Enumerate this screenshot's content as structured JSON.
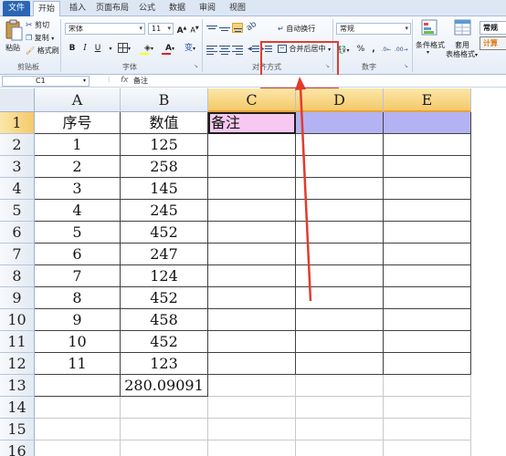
{
  "tabs": [
    "文件",
    "开始",
    "插入",
    "页面布局",
    "公式",
    "数据",
    "审阅",
    "视图"
  ],
  "clipboard": {
    "paste": "粘贴",
    "cut": "剪切",
    "copy": "复制",
    "format_painter": "格式刷",
    "group": "剪贴板"
  },
  "font": {
    "name": "宋体",
    "size": "11",
    "grow": "A",
    "shrink": "A",
    "bold": "B",
    "italic": "I",
    "underline": "U",
    "font_color_glyph": "A",
    "phonetic": "变",
    "group": "字体"
  },
  "alignment": {
    "wrap_text": "自动换行",
    "merge_center": "合并后居中",
    "group": "对齐方式"
  },
  "number": {
    "format": "常规",
    "currency": "-",
    "percent": "%",
    "comma": ",",
    "group": "数字"
  },
  "styles": {
    "conditional_format": "条件格式",
    "table_format": "套用",
    "table_format_2": "表格格式",
    "normal": "常规",
    "calculation": "计算"
  },
  "formula_bar": {
    "name_box": "C1",
    "fx": "fx",
    "value": "备注"
  },
  "columns": [
    "A",
    "B",
    "C",
    "D",
    "E"
  ],
  "rows": [
    "1",
    "2",
    "3",
    "4",
    "5",
    "6",
    "7",
    "8",
    "9",
    "10",
    "11",
    "12",
    "13",
    "14",
    "15",
    "16"
  ],
  "cells": {
    "A": [
      "序号",
      "1",
      "2",
      "3",
      "4",
      "5",
      "6",
      "7",
      "8",
      "9",
      "10",
      "11",
      "",
      "",
      "",
      ""
    ],
    "B": [
      "数值",
      "125",
      "258",
      "145",
      "245",
      "452",
      "247",
      "124",
      "452",
      "458",
      "452",
      "123",
      "280.09091",
      "",
      "",
      ""
    ],
    "C1": "备注"
  },
  "colors": {
    "file_tab": "#2a65b4",
    "header_selected": "#f5c96a",
    "c1_fill": "#f7c8f0",
    "de1_fill": "#b3b3f3",
    "annotation_red": "#e23b2e"
  }
}
